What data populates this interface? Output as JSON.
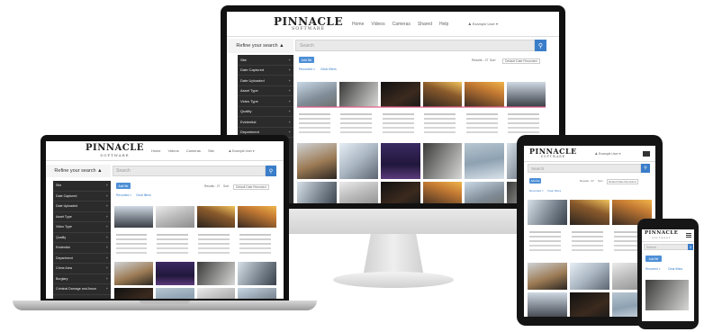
{
  "brand": {
    "logo": "PINNACLE",
    "sub": "SOFTWARE"
  },
  "nav": {
    "items": [
      "Home",
      "Videos",
      "Cameras",
      "Shared",
      "Help"
    ],
    "laptop_items": [
      "Home",
      "Videos",
      "Cameras",
      "Site"
    ]
  },
  "user": {
    "label": "Example User",
    "laptop_label": "Example User",
    "tablet_label": "Example User"
  },
  "refine": {
    "label": "Refine your search"
  },
  "search": {
    "placeholder": "Search"
  },
  "sidebar": {
    "desktop": [
      "Site",
      "Date Captured",
      "Date Uploaded",
      "Asset Type",
      "Video Type",
      "Quality",
      "Evidential",
      "Department"
    ],
    "laptop": [
      "Site",
      "Date Captured",
      "Date Uploaded",
      "Asset Type",
      "Video Type",
      "Quality",
      "Evidential",
      "Department",
      "Crime Area",
      "Burglary",
      "Criminal Damage and Arson"
    ]
  },
  "toolbar": {
    "add_file": "Add file",
    "recorded": "Recorded",
    "clear": "Clear filters",
    "results": "Results : 27",
    "sort": "Sort",
    "sort_value": "Default Date Recorded"
  },
  "phone": {
    "add_file": "Add file",
    "recorded": "Recorded",
    "clear": "Clear filters",
    "search": "Search"
  },
  "colors": {
    "accent": "#3a7dc9",
    "sidebar": "#2b2b2b",
    "highlight": "#e15e88"
  }
}
